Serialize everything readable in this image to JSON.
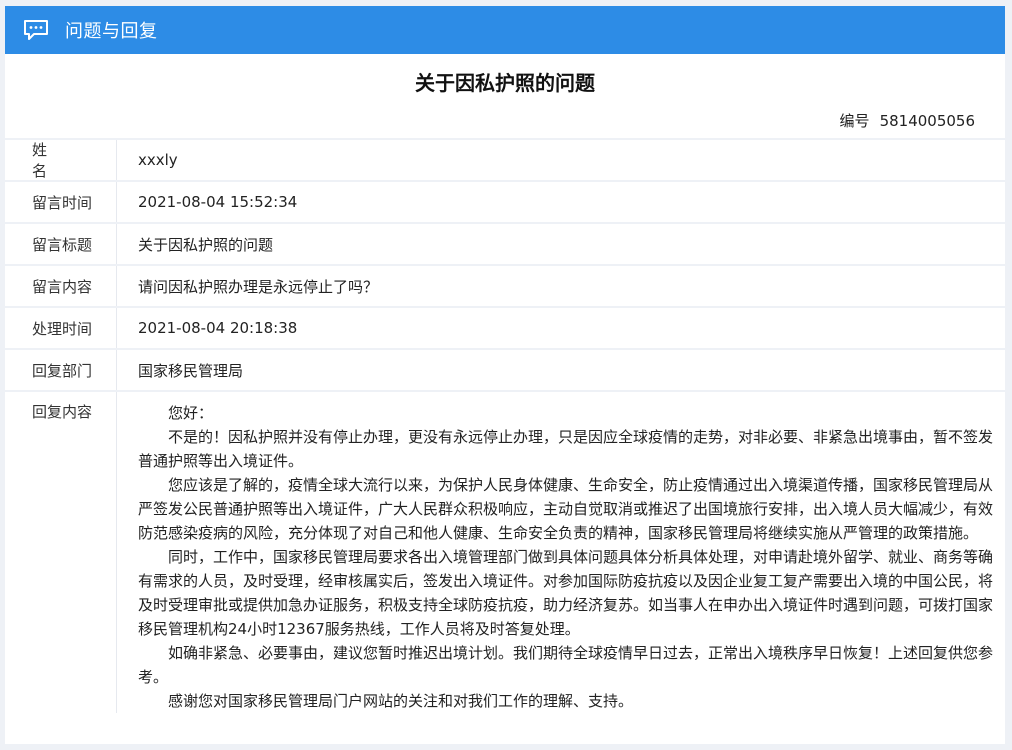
{
  "header": {
    "title": "问题与回复",
    "icon": "chat-bubble-icon",
    "color": "#2d8ce6"
  },
  "doc_title": "关于因私护照的问题",
  "number": {
    "label": "编号",
    "value": "5814005056"
  },
  "fields": [
    {
      "label": "姓名",
      "value": "xxxly"
    },
    {
      "label": "留言时间",
      "value": "2021-08-04 15:52:34"
    },
    {
      "label": "留言标题",
      "value": "关于因私护照的问题"
    },
    {
      "label": "留言内容",
      "value": "请问因私护照办理是永远停止了吗？"
    },
    {
      "label": "处理时间",
      "value": "2021-08-04 20:18:38"
    },
    {
      "label": "回复部门",
      "value": "国家移民管理局"
    }
  ],
  "reply": {
    "label": "回复内容",
    "paragraphs": [
      "您好：",
      "不是的！因私护照并没有停止办理，更没有永远停止办理，只是因应全球疫情的走势，对非必要、非紧急出境事由，暂不签发普通护照等出入境证件。",
      "您应该是了解的，疫情全球大流行以来，为保护人民身体健康、生命安全，防止疫情通过出入境渠道传播，国家移民管理局从严签发公民普通护照等出入境证件，广大人民群众积极响应，主动自觉取消或推迟了出国境旅行安排，出入境人员大幅减少，有效防范感染疫病的风险，充分体现了对自己和他人健康、生命安全负责的精神，国家移民管理局将继续实施从严管理的政策措施。",
      "同时，工作中，国家移民管理局要求各出入境管理部门做到具体问题具体分析具体处理，对申请赴境外留学、就业、商务等确有需求的人员，及时受理，经审核属实后，签发出入境证件。对参加国际防疫抗疫以及因企业复工复产需要出入境的中国公民，将及时受理审批或提供加急办证服务，积极支持全球防疫抗疫，助力经济复苏。如当事人在申办出入境证件时遇到问题，可拨打国家移民管理机构24小时12367服务热线，工作人员将及时答复处理。",
      "如确非紧急、必要事由，建议您暂时推迟出境计划。我们期待全球疫情早日过去，正常出入境秩序早日恢复！上述回复供您参考。",
      "感谢您对国家移民管理局门户网站的关注和对我们工作的理解、支持。"
    ]
  }
}
